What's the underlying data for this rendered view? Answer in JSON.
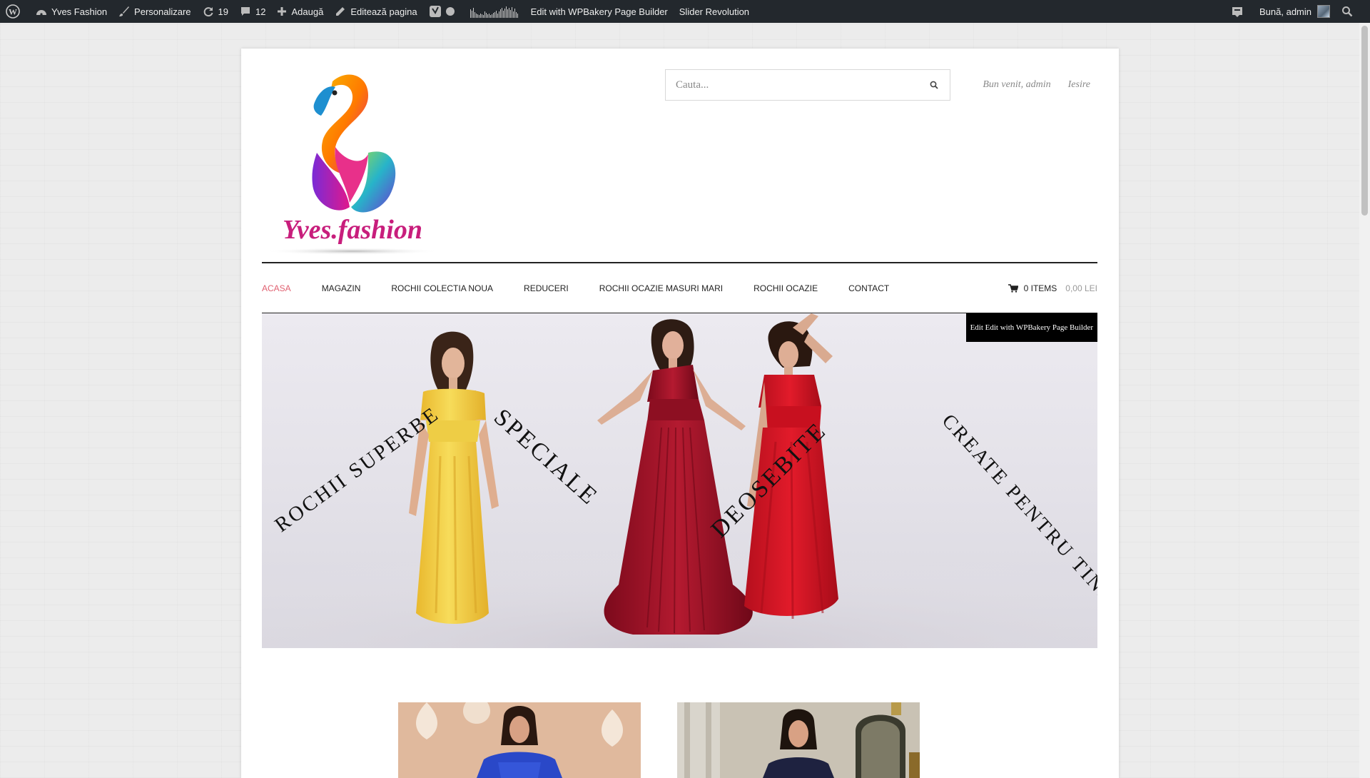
{
  "adminbar": {
    "site_name": "Yves Fashion",
    "customize": "Personalizare",
    "updates_count": "19",
    "comments_count": "12",
    "add_new": "Adaugă",
    "edit_page": "Editează pagina",
    "wpbakery": "Edit with WPBakery Page Builder",
    "slider": "Slider Revolution",
    "greeting": "Bună, admin"
  },
  "header": {
    "logo_text": "Yves.fashion",
    "search_placeholder": "Cauta...",
    "welcome": "Bun venit, admin",
    "logout": "Iesire"
  },
  "nav": {
    "items": [
      {
        "label": "ACASA"
      },
      {
        "label": "MAGAZIN"
      },
      {
        "label": "ROCHII COLECTIA NOUA"
      },
      {
        "label": "REDUCERI"
      },
      {
        "label": "ROCHII OCAZIE MASURI MARI"
      },
      {
        "label": "ROCHII OCAZIE"
      },
      {
        "label": "CONTACT"
      }
    ],
    "cart_items": "0 ITEMS",
    "cart_total": "0,00 LEI"
  },
  "hero": {
    "edit_label": "Edit Edit with WPBakery Page Builder",
    "texts": [
      "ROCHII SUPERBE",
      "SPECIALE",
      "DEOSEBITE",
      "CREATE PENTRU TINE"
    ]
  },
  "colors": {
    "adminbar_bg": "#23282d",
    "active_nav": "#e06070",
    "dress_yellow": "#f2d24a",
    "dress_maroon": "#a0142a",
    "dress_red": "#d31525"
  }
}
